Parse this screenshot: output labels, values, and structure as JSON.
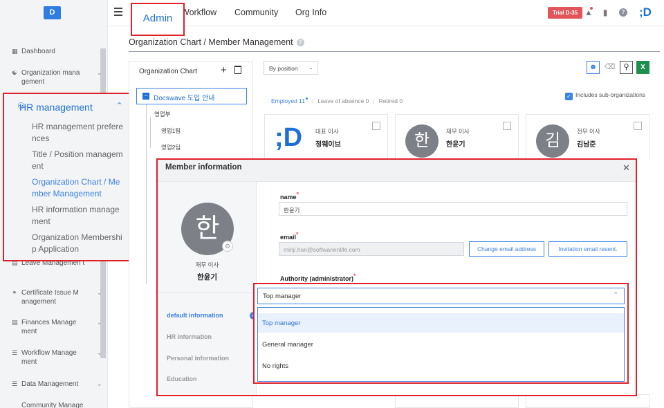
{
  "app": {
    "logo_letter": "D",
    "brand_letter": ";D",
    "trial_badge": "Trial D-35"
  },
  "nav": {
    "admin": "Admin",
    "workflow": "Workflow",
    "community": "Community",
    "org_info": "Org Info"
  },
  "sidebar": {
    "items_top": [
      {
        "label": "Dashboard"
      },
      {
        "label": "Organization mana gement"
      }
    ],
    "hr": {
      "title": "HR management",
      "subs": [
        {
          "label": "HR management prefere nces"
        },
        {
          "label": "Title / Position managem ent"
        },
        {
          "label": "Organization Chart / Me mber Management"
        },
        {
          "label": "HR information manage ment"
        },
        {
          "label": "Organization Membershi p Application"
        }
      ]
    },
    "items_bottom": [
      {
        "label": "Leave Managemen t"
      },
      {
        "label": "Certificate Issue M anagement"
      },
      {
        "label": "Finances Manage ment"
      },
      {
        "label": "Workflow Manage ment"
      },
      {
        "label": "Data Management"
      },
      {
        "label": "Community Manage"
      }
    ]
  },
  "page": {
    "title": "Organization Chart / Member Management",
    "help": "?"
  },
  "org_chart": {
    "title": "Organization Chart",
    "root": "Docswave 도입 안내",
    "nodes": [
      "영업부",
      "영업1팀",
      "영업2팀"
    ]
  },
  "toolbar": {
    "sort_select": "By position"
  },
  "filters": {
    "employed": "Employed 11",
    "leave": "Leave of absence 0",
    "retired": "Retired 0",
    "include_sub": "Includes sub-organizations"
  },
  "cards": [
    {
      "role": "대표 이사",
      "name": "정웨이브",
      "avatar": ";D"
    },
    {
      "role": "재무 이사",
      "name": "한윤기",
      "avatar": "한"
    },
    {
      "role": "전무 이사",
      "name": "김남준",
      "avatar": "김"
    }
  ],
  "modal": {
    "title": "Member information",
    "avatar": "한",
    "role": "재무 이사",
    "name": "한윤기",
    "tabs": [
      "default information",
      "HR information",
      "Personal information",
      "Education"
    ],
    "fields": {
      "name_label": "name",
      "name_value": "한윤기",
      "email_label": "email",
      "email_value": "minji.han@softwareinlife.com",
      "change_email": "Change email address",
      "resend": "Invitation email resent.",
      "authority_label": "Authority (administrator)"
    }
  },
  "authority": {
    "selected": "Top manager",
    "options": [
      "Top manager",
      "General manager",
      "No rights"
    ]
  },
  "colors": {
    "accent": "#1f6fd8",
    "highlight": "#e0202a",
    "excel": "#1e8f4e"
  }
}
